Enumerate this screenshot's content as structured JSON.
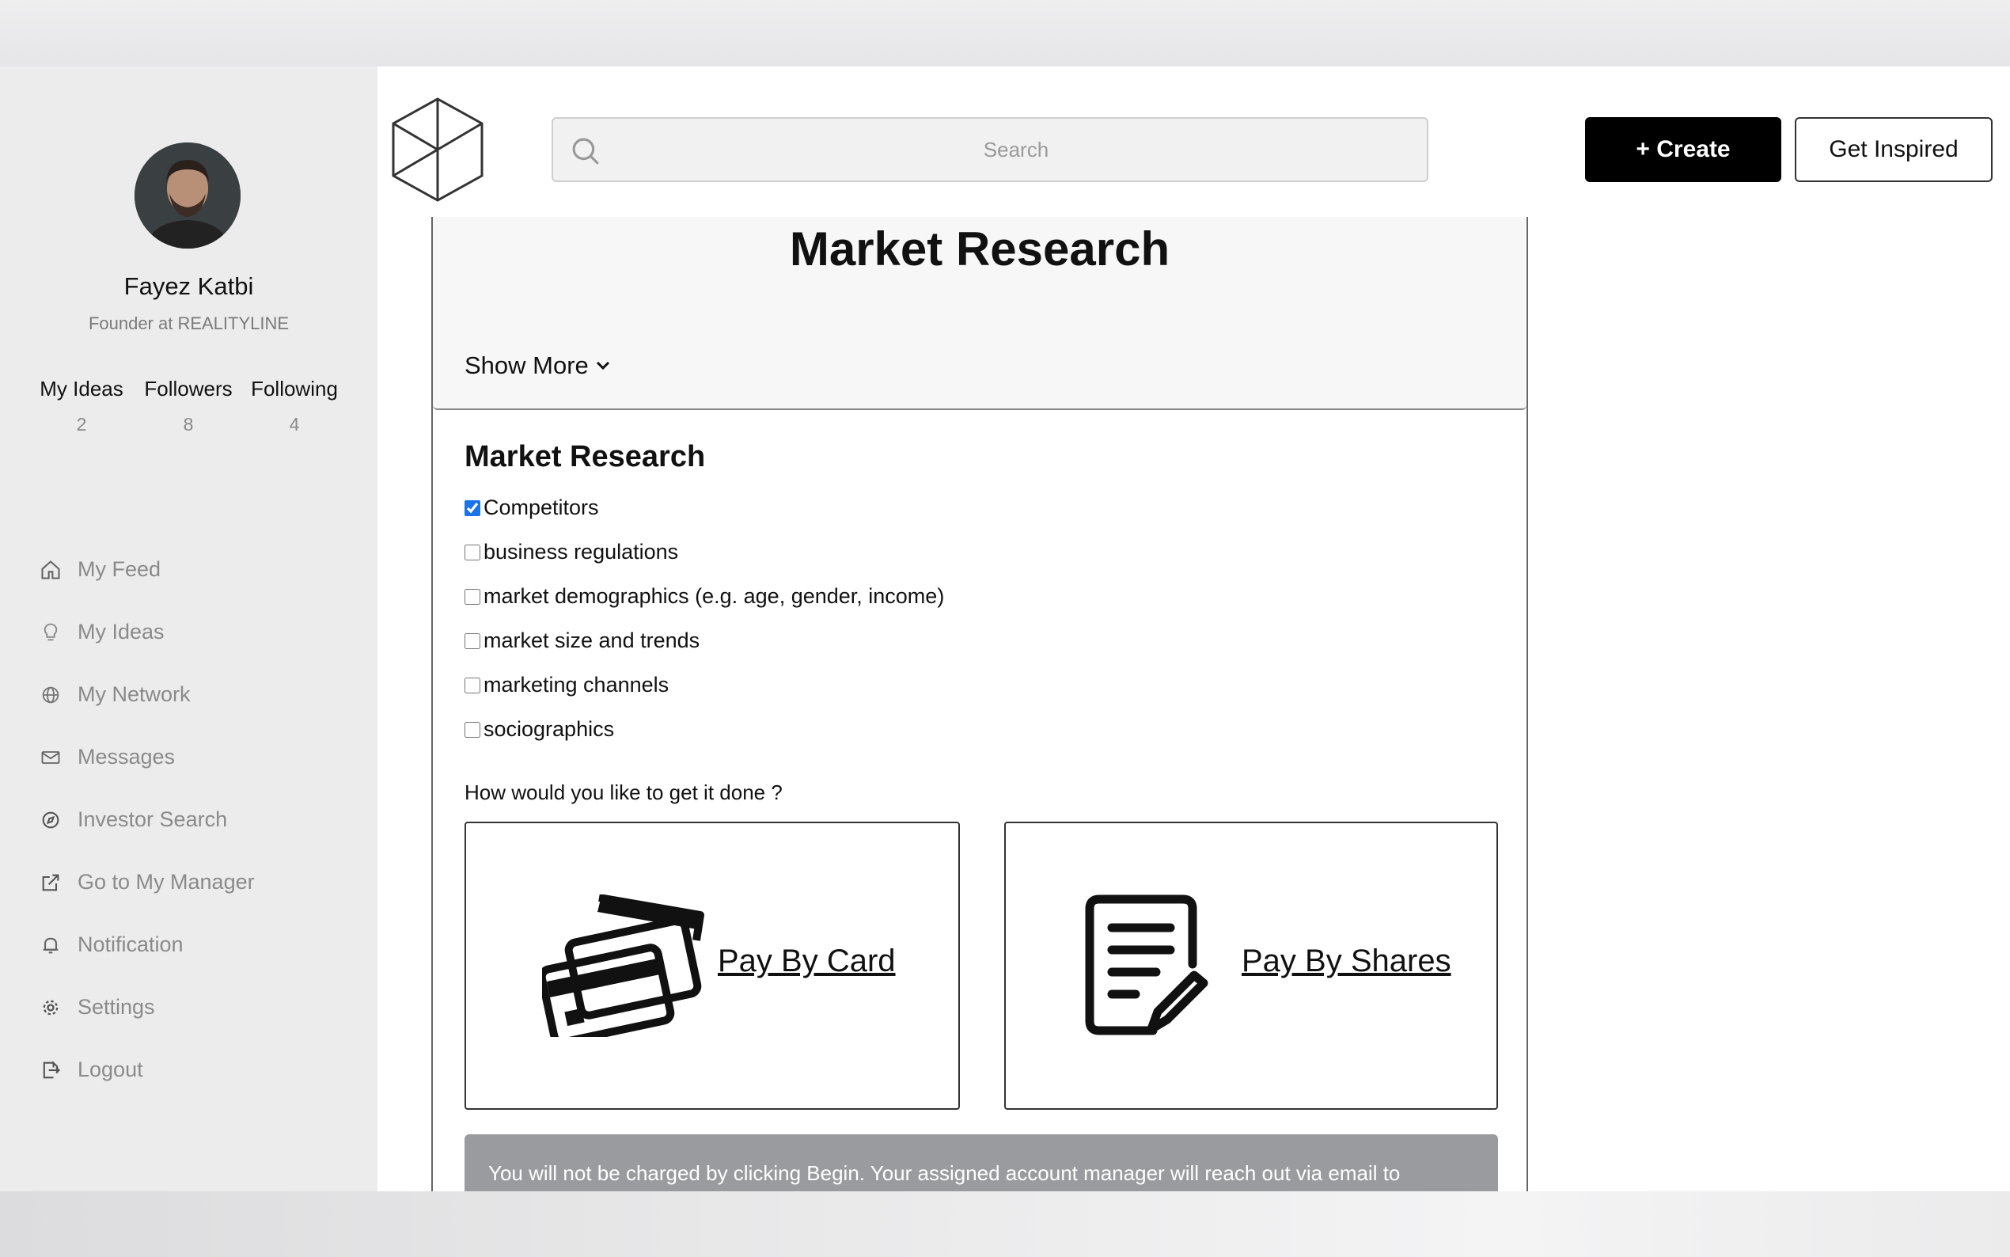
{
  "user": {
    "name": "Fayez Katbi",
    "role": "Founder at REALITYLINE"
  },
  "stats": [
    {
      "label": "My Ideas",
      "value": "2"
    },
    {
      "label": "Followers",
      "value": "8"
    },
    {
      "label": "Following",
      "value": "4"
    }
  ],
  "nav": [
    {
      "label": "My Feed",
      "icon": "home-icon"
    },
    {
      "label": "My Ideas",
      "icon": "lightbulb-icon"
    },
    {
      "label": "My Network",
      "icon": "globe-icon"
    },
    {
      "label": "Messages",
      "icon": "mail-icon"
    },
    {
      "label": "Investor Search",
      "icon": "compass-icon"
    },
    {
      "label": "Go to My Manager",
      "icon": "external-link-icon"
    },
    {
      "label": "Notification",
      "icon": "bell-icon"
    },
    {
      "label": "Settings",
      "icon": "gear-icon"
    },
    {
      "label": "Logout",
      "icon": "logout-icon"
    }
  ],
  "header": {
    "search_placeholder": "Search",
    "create_label": "+ Create",
    "inspire_label": "Get Inspired"
  },
  "main": {
    "card_title": "Market Research",
    "show_more": "Show More",
    "section_title": "Market Research",
    "checklist": [
      {
        "label": "Competitors",
        "checked": true
      },
      {
        "label": "business regulations",
        "checked": false
      },
      {
        "label": "market demographics (e.g. age, gender, income)",
        "checked": false
      },
      {
        "label": "market size and trends",
        "checked": false
      },
      {
        "label": "marketing channels",
        "checked": false
      },
      {
        "label": "sociographics",
        "checked": false
      }
    ],
    "question": "How would you like to get it done ?",
    "pay_card_label": "Pay By Card",
    "pay_shares_label": "Pay By Shares",
    "notice": "You will not be charged by clicking Begin. Your assigned account manager will reach out via email to"
  },
  "colors": {
    "sidebar_bg": "#ececed",
    "nav_text": "#8a8a8a",
    "primary_button": "#000000",
    "notice_bg": "#9a9b9e",
    "checkbox_accent": "#1a73e8"
  }
}
